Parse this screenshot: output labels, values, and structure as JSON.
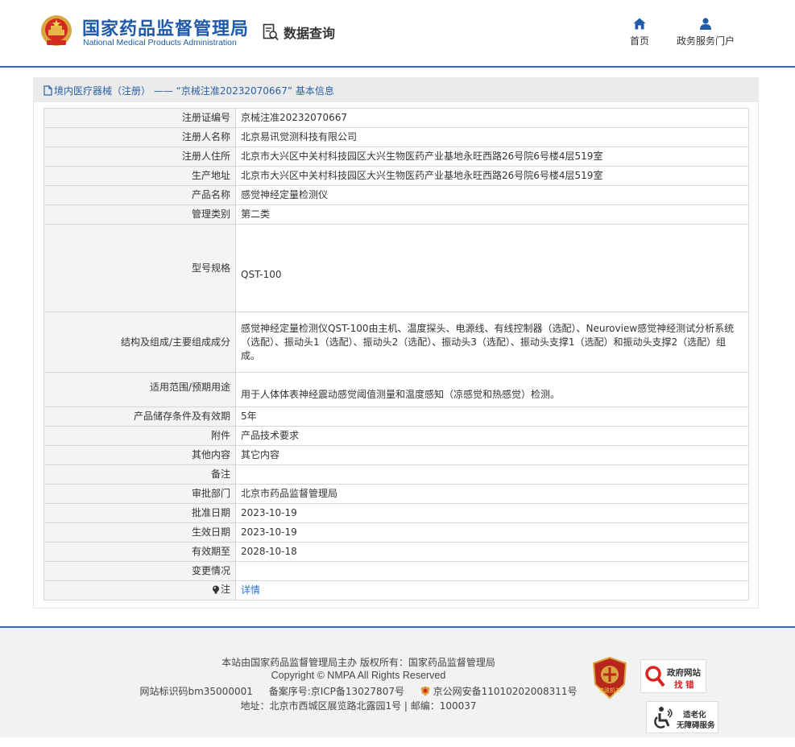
{
  "header": {
    "site_name_cn": "国家药品监督管理局",
    "site_name_en": "National Medical Products Administration",
    "query_label": "数据查询",
    "nav": {
      "home": "首页",
      "portal": "政务服务门户"
    }
  },
  "panel": {
    "title": "境内医疗器械（注册） —— “京械注准20232070667” 基本信息"
  },
  "table": {
    "rows": [
      {
        "label": "注册证编号",
        "value": "京械注准20232070667"
      },
      {
        "label": "注册人名称",
        "value": "北京易讯觉测科技有限公司"
      },
      {
        "label": "注册人住所",
        "value": "北京市大兴区中关村科技园区大兴生物医药产业基地永旺西路26号院6号楼4层519室"
      },
      {
        "label": "生产地址",
        "value": "北京市大兴区中关村科技园区大兴生物医药产业基地永旺西路26号院6号楼4层519室"
      },
      {
        "label": "产品名称",
        "value": "感觉神经定量检测仪"
      },
      {
        "label": "管理类别",
        "value": "第二类"
      },
      {
        "label": "型号规格",
        "value": "QST-100"
      },
      {
        "label": "结构及组成/主要组成成分",
        "value": "感觉神经定量检测仪QST-100由主机、温度探头、电源线、有线控制器（选配）、Neuroview感觉神经测试分析系统（选配）、振动头1（选配）、振动头2（选配）、振动头3（选配）、振动头支撑1（选配）和振动头支撑2（选配）组成。"
      },
      {
        "label": "适用范围/预期用途",
        "value": "用于人体体表神经震动感觉阈值测量和温度感知（凉感觉和热感觉）检测。"
      },
      {
        "label": "产品储存条件及有效期",
        "value": "5年"
      },
      {
        "label": "附件",
        "value": "产品技术要求"
      },
      {
        "label": "其他内容",
        "value": "其它内容"
      },
      {
        "label": "备注",
        "value": ""
      },
      {
        "label": "审批部门",
        "value": "北京市药品监督管理局"
      },
      {
        "label": "批准日期",
        "value": "2023-10-19"
      },
      {
        "label": "生效日期",
        "value": "2023-10-19"
      },
      {
        "label": "有效期至",
        "value": "2028-10-18"
      },
      {
        "label": "变更情况",
        "value": ""
      },
      {
        "label": "注",
        "value": "详情"
      }
    ]
  },
  "footer": {
    "line1": "本站由国家药品监督管理局主办 版权所有：国家药品监督管理局",
    "line2": "Copyright © NMPA All Rights Reserved",
    "site_id": "网站标识码bm35000001",
    "icp": "备案序号:京ICP备13027807号",
    "police": "京公网安备11010202008311号",
    "address": "地址：北京市西城区展览路北露园1号 | 邮编：100037",
    "badge_party": "党政机关",
    "badge_zfwz_1": "政府网站",
    "badge_zfwz_2": "找 错",
    "badge_access_1": "适老化",
    "badge_access_2": "无障碍服务"
  },
  "colors": {
    "brand_blue": "#1f5ba8",
    "link_blue": "#2a6fc9",
    "label_bg": "#f4f4f4"
  }
}
